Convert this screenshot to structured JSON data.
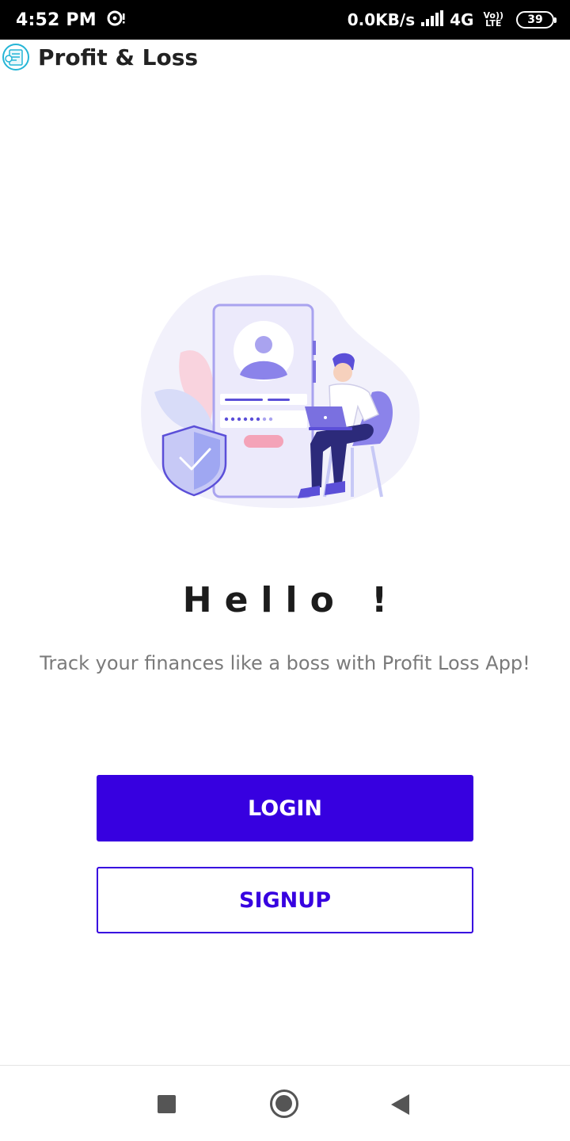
{
  "status_bar": {
    "time": "4:52 PM",
    "net_speed": "0.0KB/s",
    "network": "4G",
    "volte_top": "Vo))",
    "volte_bottom": "LTE",
    "battery": "39"
  },
  "app_bar": {
    "title": "Profit & Loss",
    "logo_icon": "profit-loss-logo-icon"
  },
  "main": {
    "greeting": "Hello !",
    "tagline": "Track your finances like a boss with Profit Loss App!"
  },
  "buttons": {
    "login_label": "LOGIN",
    "signup_label": "SIGNUP"
  },
  "colors": {
    "primary": "#3700e0",
    "illustration_purple": "#5b4fd8",
    "illustration_lavender": "#a9a3ef",
    "illustration_pink": "#f4a3b8"
  },
  "nav_bar": {
    "icons": [
      "recents-icon",
      "home-icon",
      "back-icon"
    ]
  }
}
